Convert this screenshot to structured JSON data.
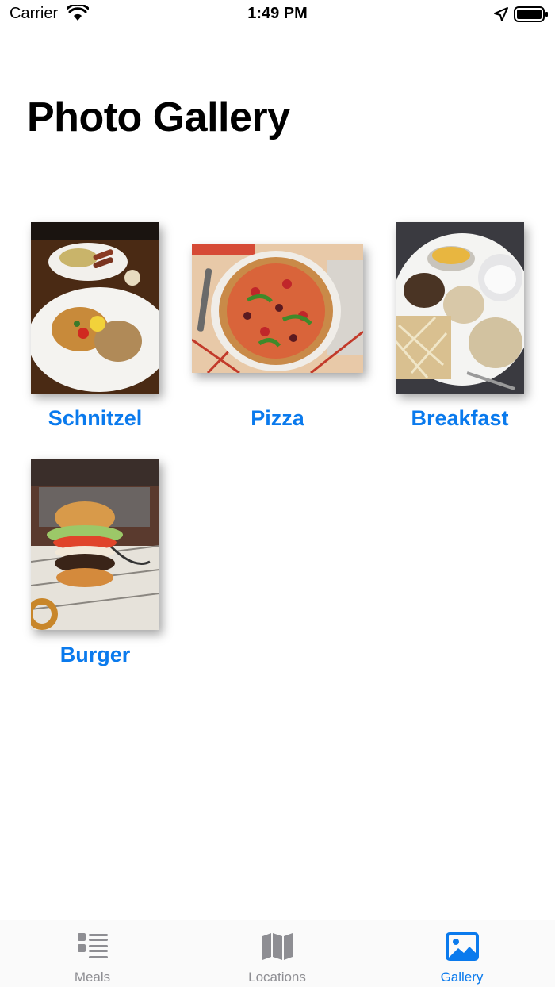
{
  "status_bar": {
    "carrier": "Carrier",
    "time": "1:49 PM"
  },
  "header": {
    "title": "Photo Gallery"
  },
  "gallery": {
    "items": [
      {
        "label": "Schnitzel"
      },
      {
        "label": "Pizza"
      },
      {
        "label": "Breakfast"
      },
      {
        "label": "Burger"
      }
    ]
  },
  "tab_bar": {
    "tabs": [
      {
        "label": "Meals",
        "icon": "list-icon",
        "active": false
      },
      {
        "label": "Locations",
        "icon": "map-icon",
        "active": false
      },
      {
        "label": "Gallery",
        "icon": "photo-icon",
        "active": true
      }
    ]
  },
  "colors": {
    "accent": "#0a7aed",
    "inactive": "#8e8e93"
  }
}
